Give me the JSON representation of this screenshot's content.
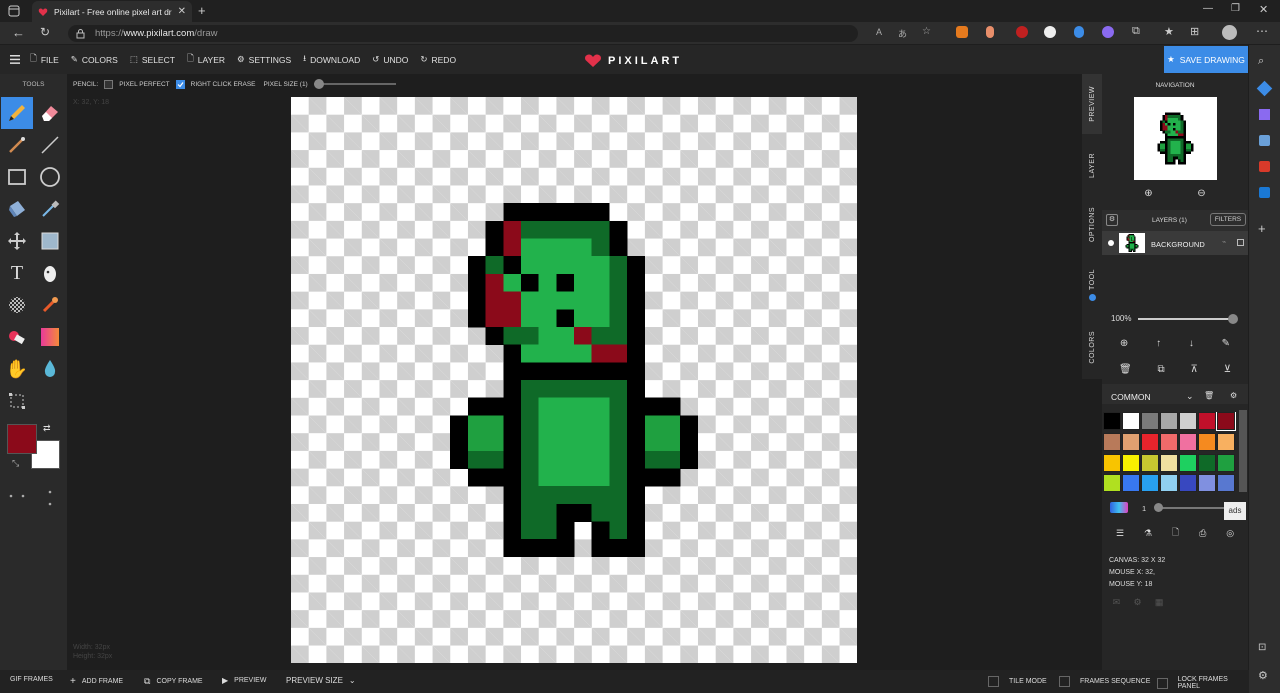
{
  "browser": {
    "tab_title": "Pixilart - Free online pixel art dra...",
    "url_prefix": "https://",
    "url_host": "www.pixilart.com",
    "url_path": "/draw"
  },
  "toolbar": {
    "file": "FILE",
    "colors": "COLORS",
    "select": "SELECT",
    "layer": "LAYER",
    "settings": "SETTINGS",
    "download": "DOWNLOAD",
    "undo": "UNDO",
    "redo": "REDO",
    "logo": "PIXILART",
    "save": "SAVE DRAWING"
  },
  "tools": {
    "title": "TOOLS",
    "primary_color": "#8b0a1a",
    "secondary_color": "#ffffff"
  },
  "options": {
    "label": "PENCIL:",
    "pixel_perfect": "PIXEL PERFECT",
    "pixel_perfect_checked": false,
    "right_click_erase": "RIGHT CLICK ERASE",
    "right_click_erase_checked": true,
    "pixel_size": "PIXEL SIZE (1)"
  },
  "workspace": {
    "coords": "X: 32, Y: 18",
    "width_label": "Width: 32px",
    "height_label": "Height: 32px"
  },
  "sidetabs": {
    "preview": "PREVIEW",
    "layer": "LAYER",
    "options": "OPTIONS",
    "tool": "TOOL",
    "colors": "COLORS"
  },
  "panel": {
    "navigation": "NAVIGATION",
    "layers_title": "LAYERS (1)",
    "filters": "FILTERS",
    "layer_name": "BACKGROUND",
    "opacity": "100%",
    "palette_name": "COMMON",
    "brush_size": "1",
    "ads": "ads",
    "canvas_info": "CANVAS: 32 X 32",
    "mouse_x": "MOUSE X: 32,",
    "mouse_y": "MOUSE Y: 18"
  },
  "palette": [
    "#000000",
    "#ffffff",
    "#7a7a7a",
    "#a8a8a8",
    "#cfcfcf",
    "#c0102a",
    "#8b0a1a",
    "#b87a5a",
    "#e0a070",
    "#e8242c",
    "#f06a6a",
    "#f070a0",
    "#f58a1f",
    "#f8b060",
    "#f8c400",
    "#f8f000",
    "#c8c830",
    "#f0e0a0",
    "#1ed060",
    "#0f6a28",
    "#1fa040",
    "#b0e020",
    "#3878f0",
    "#28a0f0",
    "#90d0f0",
    "#3848c0",
    "#8090e0",
    "#5878d0"
  ],
  "bottom": {
    "gif_frames": "GIF FRAMES",
    "add_frame": "ADD FRAME",
    "copy_frame": "COPY FRAME",
    "preview": "PREVIEW",
    "preview_size": "PREVIEW SIZE",
    "tile_mode": "TILE MODE",
    "frames_sequence": "FRAMES SEQUENCE",
    "lock_frames_panel": "LOCK FRAMES PANEL"
  },
  "artwork": {
    "grid": 32,
    "colors": {
      "K": "#000000",
      "D": "#0f6a28",
      "G": "#1fa040",
      "L": "#22b24c",
      "R": "#8b0a1a"
    },
    "rows": [
      "................................",
      "................................",
      "................................",
      "................................",
      "................................",
      "................................",
      "............KKKKKK..............",
      "...........KRDDDDDK.............",
      "...........KRLLLLDK.............",
      "..........KDKLLLLLDK............",
      "..........KRLKLKLLDK............",
      "..........KRRLLLLLDK............",
      "..........KRRLLKLLDK............",
      "...........KDDLLRDDK............",
      "............KLLLLRRK............",
      "............KKKKKKKK............",
      "............KDDDDDDK............",
      "..........KKKDLLLLDKKK..........",
      ".........KGGKDLLLLDKGGK.........",
      ".........KGGKDLLLLDKGGK.........",
      ".........KDDKDLLLLDKDDK.........",
      "..........KKKDLLLLDKKK..........",
      "............KDDDDDDK............",
      "............KDDKKDDK............",
      "............KDDK.KDK............",
      "............KKKK.KKK............",
      "................................",
      "................................",
      "................................",
      "................................",
      "................................",
      "................................"
    ]
  }
}
